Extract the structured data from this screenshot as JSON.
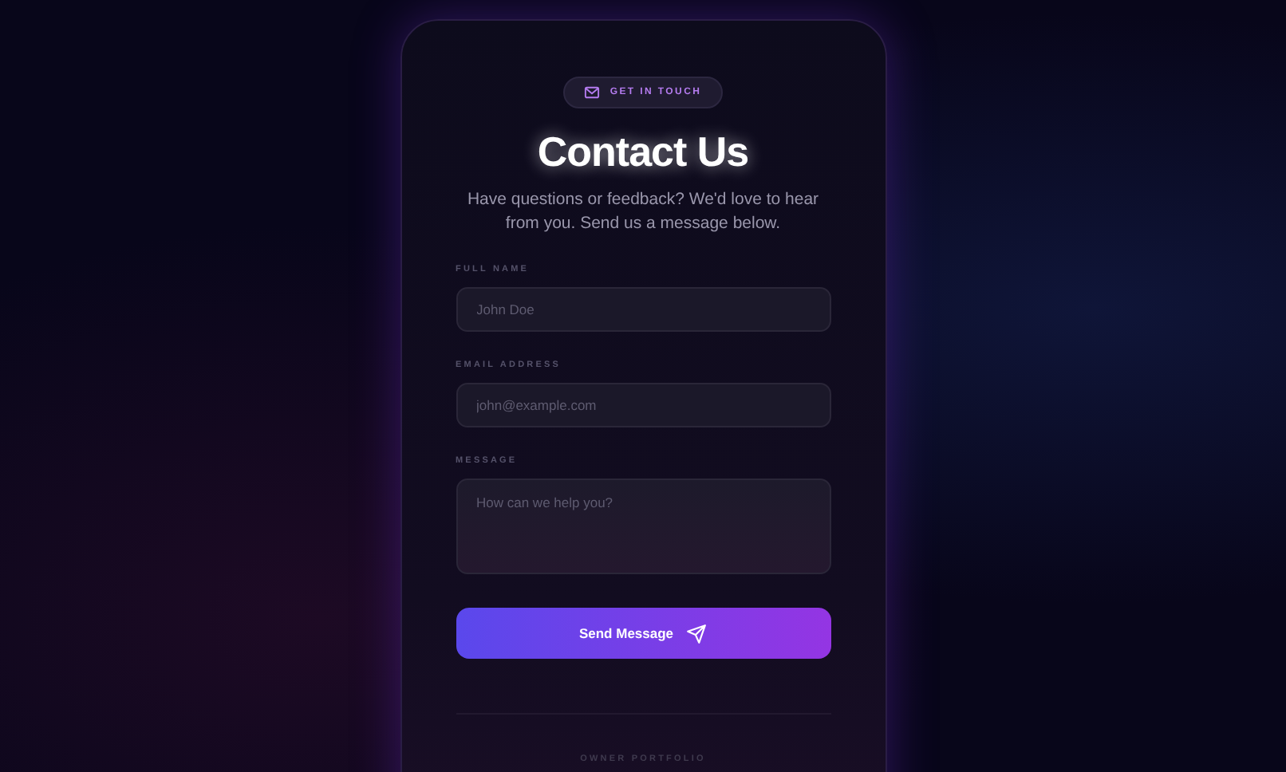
{
  "badge": {
    "label": "GET IN TOUCH"
  },
  "title": "Contact Us",
  "subtitle": "Have questions or feedback? We'd love to hear from you. Send us a message below.",
  "fields": [
    {
      "kind": "input",
      "label": "FULL NAME",
      "placeholder": "John Doe"
    },
    {
      "kind": "input",
      "label": "EMAIL ADDRESS",
      "placeholder": "john@example.com"
    },
    {
      "kind": "textarea",
      "label": "MESSAGE",
      "placeholder": "How can we help you?"
    }
  ],
  "submit": {
    "label": "Send Message"
  },
  "footer": {
    "label": "OWNER PORTFOLIO"
  }
}
